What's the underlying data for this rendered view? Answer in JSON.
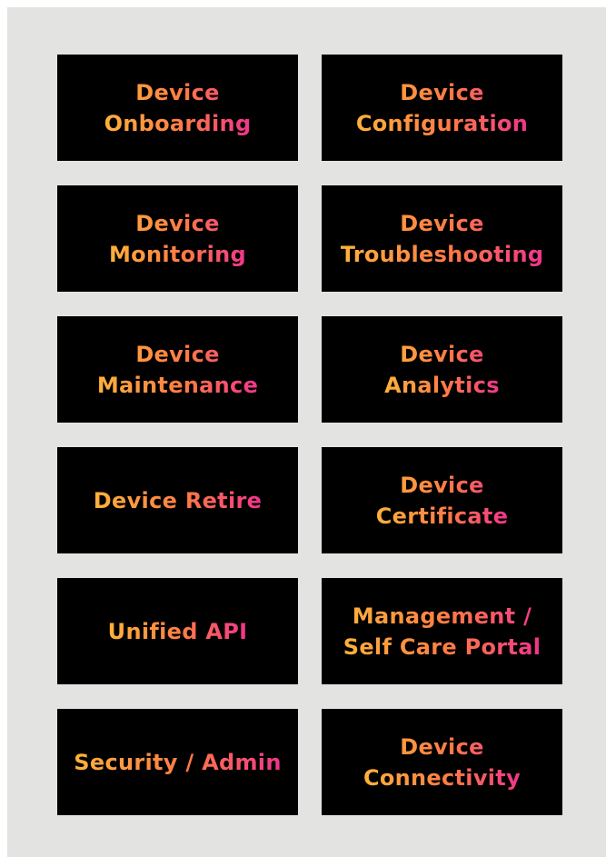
{
  "tiles": [
    {
      "label": "Device\nOnboarding"
    },
    {
      "label": "Device\nConfiguration"
    },
    {
      "label": "Device\nMonitoring"
    },
    {
      "label": "Device\nTroubleshooting"
    },
    {
      "label": "Device\nMaintenance"
    },
    {
      "label": "Device\nAnalytics"
    },
    {
      "label": "Device Retire"
    },
    {
      "label": "Device\nCertificate"
    },
    {
      "label": "Unified API"
    },
    {
      "label": "Management /\nSelf Care Portal"
    },
    {
      "label": "Security / Admin"
    },
    {
      "label": "Device\nConnectivity"
    }
  ],
  "colors": {
    "background": "#e3e3e1",
    "tile": "#000000",
    "gradient_start": "#ffb23a",
    "gradient_mid": "#ff7a45",
    "gradient_end": "#f0348c"
  }
}
